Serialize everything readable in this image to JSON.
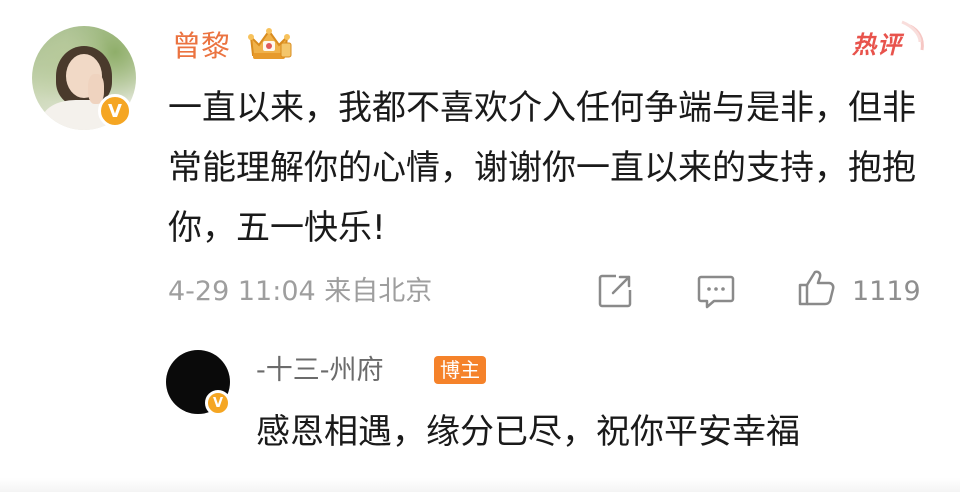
{
  "comment": {
    "username": "曾黎",
    "text": "一直以来，我都不喜欢介入任何争端与是非，但非常能理解你的心情，谢谢你一直以来的支持，抱抱你，五一快乐!",
    "verified_badge": "V",
    "hot_label": "热评",
    "time_location": "4-29 11:04 来自北京",
    "likes": "1119",
    "icons": [
      "crown-badge-icon",
      "share-icon",
      "comment-icon",
      "thumbs-up-icon",
      "verified-icon"
    ],
    "colors": {
      "username": "#eb7340",
      "hot": "#e8534c",
      "verified": "#f5a623"
    }
  },
  "reply": {
    "username": "-十三-州府",
    "badge": "博主",
    "verified_badge": "V",
    "text": "感恩相遇，缘分已尽，祝你平安幸福",
    "colors": {
      "badge_bg": "#f5822a"
    }
  }
}
